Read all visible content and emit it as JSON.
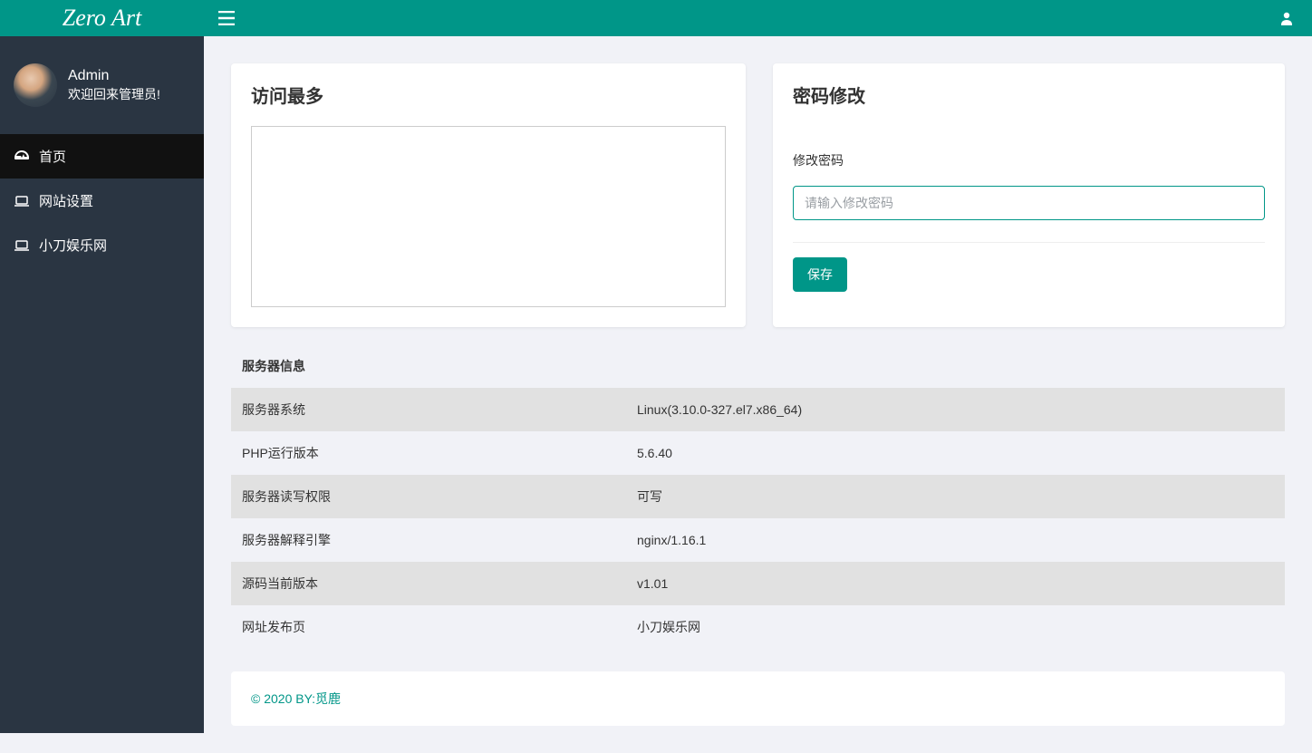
{
  "brand": "Zero Art",
  "profile": {
    "name": "Admin",
    "welcome": "欢迎回来管理员!"
  },
  "nav": [
    {
      "label": "首页"
    },
    {
      "label": "网站设置"
    },
    {
      "label": "小刀娱乐网"
    }
  ],
  "panel_visit": {
    "title": "访问最多"
  },
  "panel_pwd": {
    "title": "密码修改",
    "label": "修改密码",
    "placeholder": "请输入修改密码",
    "save": "保存"
  },
  "server_info": {
    "title": "服务器信息",
    "rows": [
      {
        "k": "服务器系统",
        "v": "Linux(3.10.0-327.el7.x86_64)",
        "cls": ""
      },
      {
        "k": "PHP运行版本",
        "v": "5.6.40",
        "cls": ""
      },
      {
        "k": "服务器读写权限",
        "v": "可写",
        "cls": "val-green"
      },
      {
        "k": "服务器解释引擎",
        "v": "nginx/1.16.1",
        "cls": ""
      },
      {
        "k": "源码当前版本",
        "v": "v1.01",
        "cls": ""
      },
      {
        "k": "网址发布页",
        "v": "小刀娱乐网",
        "cls": "val-teal"
      }
    ]
  },
  "footer": "© 2020 BY:觅鹿"
}
